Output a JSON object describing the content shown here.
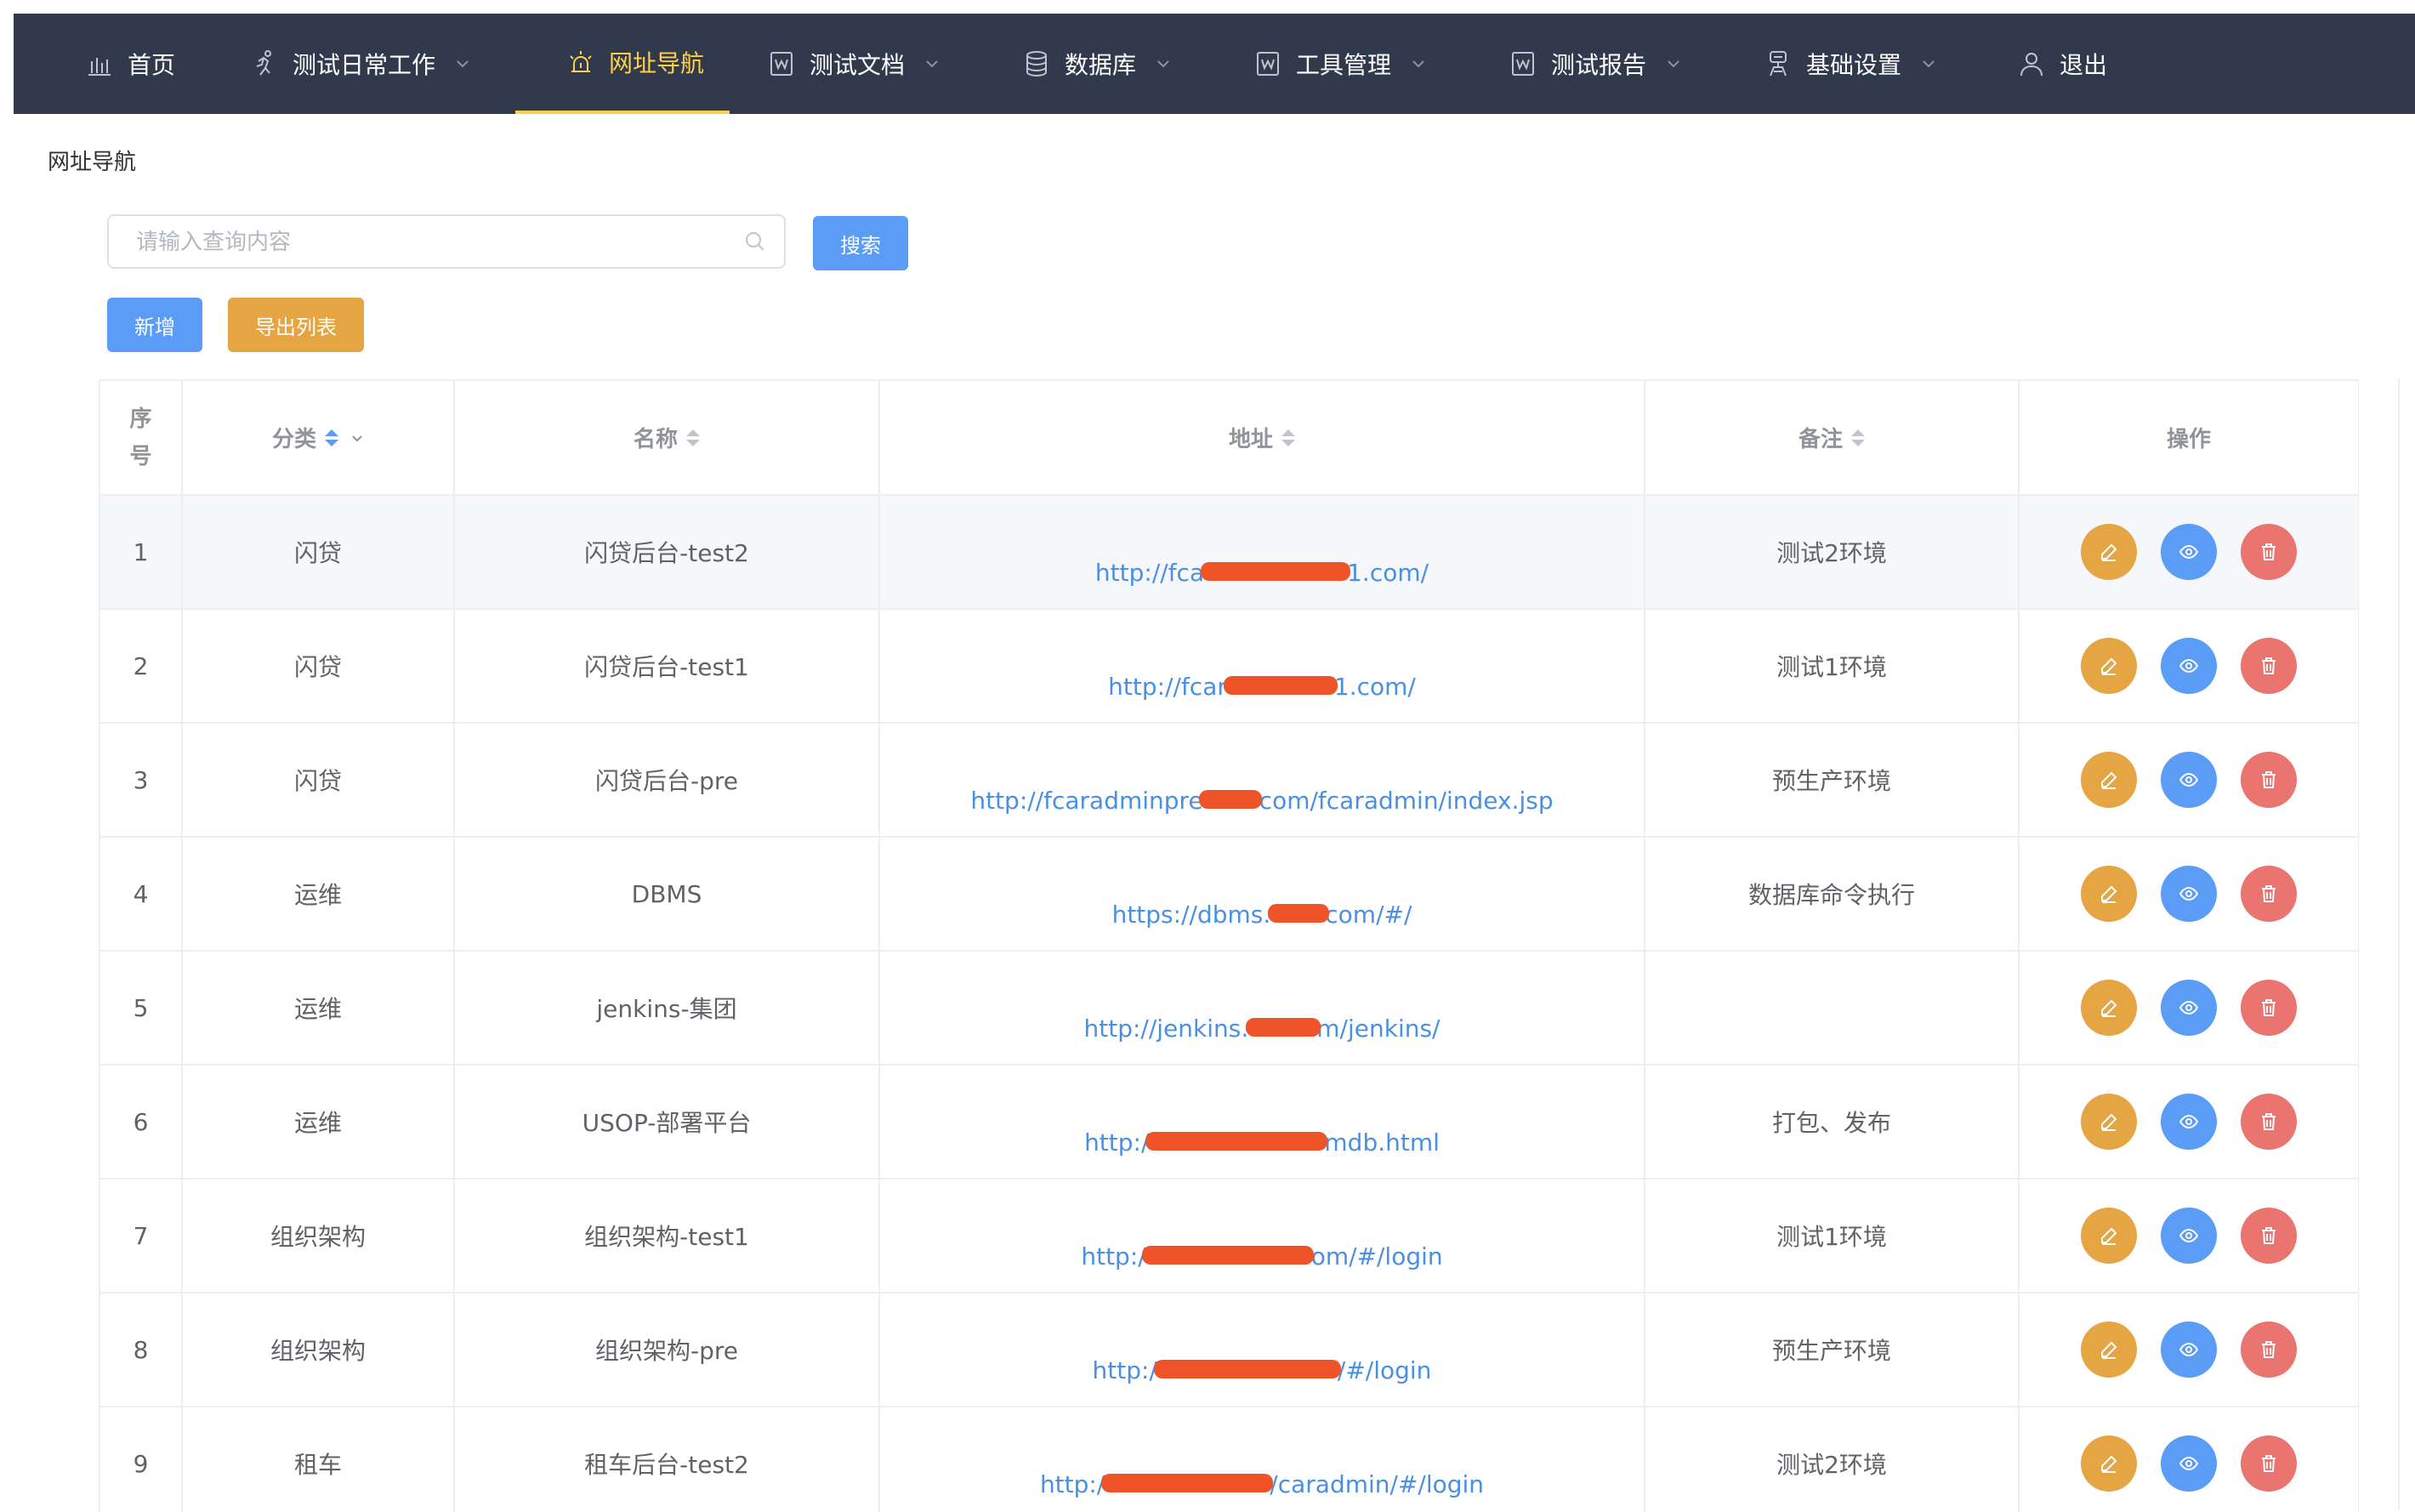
{
  "nav": {
    "items": [
      {
        "label": "首页",
        "icon": "bar-chart-icon",
        "dropdown": false
      },
      {
        "label": "测试日常工作",
        "icon": "running-man-icon",
        "dropdown": true
      },
      {
        "label": "网址导航",
        "icon": "alarm-light-icon",
        "dropdown": false,
        "active": true
      },
      {
        "label": "测试文档",
        "icon": "document-icon",
        "dropdown": true
      },
      {
        "label": "数据库",
        "icon": "database-icon",
        "dropdown": true
      },
      {
        "label": "工具管理",
        "icon": "document-icon",
        "dropdown": true
      },
      {
        "label": "测试报告",
        "icon": "document-icon",
        "dropdown": true
      },
      {
        "label": "基础设置",
        "icon": "settings-person-icon",
        "dropdown": true
      },
      {
        "label": "退出",
        "icon": "user-icon",
        "dropdown": false
      }
    ],
    "active_color": "#ffd04b",
    "background": "#303a4c"
  },
  "page": {
    "title": "网址导航"
  },
  "search": {
    "placeholder": "请输入查询内容",
    "value": "",
    "button_label": "搜索"
  },
  "actions": {
    "add_label": "新增",
    "export_label": "导出列表"
  },
  "table": {
    "headers": {
      "seq": "序号",
      "category": "分类",
      "name": "名称",
      "address": "地址",
      "remark": "备注",
      "ops": "操作"
    },
    "rows": [
      {
        "seq": "1",
        "category": "闪贷",
        "name": "闪贷后台-test2",
        "addr_prefix": "http://fca",
        "addr_suffix": "1.com/",
        "remark": "测试2环境"
      },
      {
        "seq": "2",
        "category": "闪贷",
        "name": "闪贷后台-test1",
        "addr_prefix": "http://fcar",
        "addr_suffix": "1.com/",
        "remark": "测试1环境"
      },
      {
        "seq": "3",
        "category": "闪贷",
        "name": "闪贷后台-pre",
        "addr_prefix": "http://fcaradminpre",
        "addr_suffix": "com/fcaradmin/index.jsp",
        "remark": "预生产环境"
      },
      {
        "seq": "4",
        "category": "运维",
        "name": "DBMS",
        "addr_prefix": "https://dbms.",
        "addr_suffix": "com/#/",
        "remark": "数据库命令执行"
      },
      {
        "seq": "5",
        "category": "运维",
        "name": "jenkins-集团",
        "addr_prefix": "http://jenkins.",
        "addr_suffix": "m/jenkins/",
        "remark": ""
      },
      {
        "seq": "6",
        "category": "运维",
        "name": "USOP-部署平台",
        "addr_prefix": "http:/",
        "addr_suffix": "mdb.html",
        "remark": "打包、发布"
      },
      {
        "seq": "7",
        "category": "组织架构",
        "name": "组织架构-test1",
        "addr_prefix": "http:/",
        "addr_suffix": "om/#/login",
        "remark": "测试1环境"
      },
      {
        "seq": "8",
        "category": "组织架构",
        "name": "组织架构-pre",
        "addr_prefix": "http:/",
        "addr_suffix": "/#/login",
        "remark": "预生产环境"
      },
      {
        "seq": "9",
        "category": "租车",
        "name": "租车后台-test2",
        "addr_prefix": "http:/",
        "addr_suffix": "/caradmin/#/login",
        "remark": "测试2环境"
      }
    ]
  },
  "colors": {
    "primary": "#5b9cf6",
    "warning": "#e5a543",
    "danger": "#e97470",
    "link": "#4a90e2"
  }
}
